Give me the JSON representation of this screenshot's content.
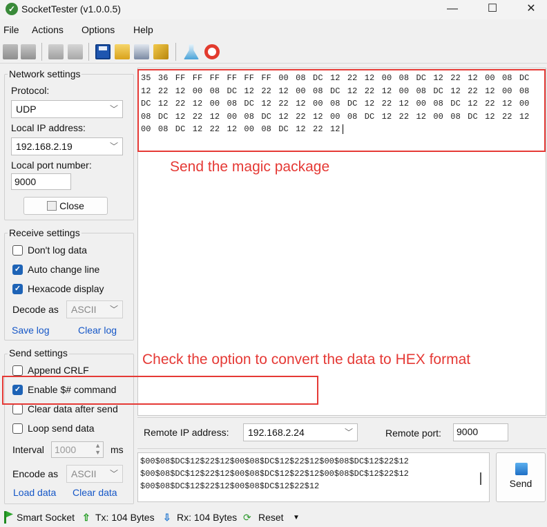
{
  "window": {
    "title": "SocketTester (v1.0.0.5)",
    "minimize": "—",
    "maximize": "☐",
    "close": "✕"
  },
  "menu": [
    {
      "label": "File"
    },
    {
      "label": "Actions"
    },
    {
      "label": "Options"
    },
    {
      "label": "Help"
    }
  ],
  "toolbar_icons": [
    "connect-icon",
    "disconnect-icon",
    "send-file-icon",
    "stop-icon",
    "save-icon",
    "open-folder-icon",
    "print-icon",
    "clear-broom-icon",
    "test-flask-icon",
    "help-lifebuoy-icon"
  ],
  "network": {
    "title": "Network settings",
    "protocol_label": "Protocol:",
    "protocol_value": "UDP",
    "local_ip_label": "Local IP address:",
    "local_ip_value": "192.168.2.19",
    "local_port_label": "Local port number:",
    "local_port_value": "9000",
    "close_label": "Close"
  },
  "receive": {
    "title": "Receive settings",
    "dont_log": {
      "label": "Don't log data",
      "checked": false
    },
    "auto_change_line": {
      "label": "Auto change line",
      "checked": true
    },
    "hexcode_display": {
      "label": "Hexacode display",
      "checked": true
    },
    "decode_label": "Decode as",
    "decode_value": "ASCII",
    "save_log": "Save log",
    "clear_log": "Clear log"
  },
  "send_settings": {
    "title": "Send settings",
    "append_crlf": {
      "label": "Append CRLF",
      "checked": false
    },
    "enable_cmd": {
      "label": "Enable $# command",
      "checked": true
    },
    "clear_after_send": {
      "label": "Clear data after send",
      "checked": false
    },
    "loop_send": {
      "label": "Loop send data",
      "checked": false
    },
    "interval_label": "Interval",
    "interval_value": "1000",
    "interval_unit": "ms",
    "encode_label": "Encode as",
    "encode_value": "ASCII",
    "load_data": "Load data",
    "clear_data": "Clear data"
  },
  "receive_log": {
    "lines": [
      "35 36 FF FF FF FF FF FF 00 08 DC 12 22 12 00 08 DC 12 22 12 00 08 DC",
      "12 22 12 00 08 DC 12 22 12 00 08 DC 12 22 12 00 08 DC 12 22 12 00 08",
      "DC 12 22 12 00 08 DC 12 22 12 00 08 DC 12 22 12 00 08 DC 12 22 12 00",
      "08 DC 12 22 12 00 08 DC 12 22 12 00 08 DC 12 22 12 00 08 DC 12 22 12",
      "00 08 DC 12 22 12 00 08 DC 12 22 12"
    ]
  },
  "annotations": {
    "magic": "Send the magic package",
    "hex": "Check the option to convert the data to HEX format"
  },
  "remote": {
    "ip_label": "Remote IP address:",
    "ip_value": "192.168.2.24",
    "port_label": "Remote port:",
    "port_value": "9000"
  },
  "send_box": {
    "lines": [
      "$00$08$DC$12$22$12$00$08$DC$12$22$12$00$08$DC$12$22$12",
      "$00$08$DC$12$22$12$00$08$DC$12$22$12$00$08$DC$12$22$12",
      "$00$08$DC$12$22$12$00$08$DC$12$22$12"
    ],
    "send_label": "Send"
  },
  "status": {
    "smart_socket": "Smart Socket",
    "tx": "Tx: 104 Bytes",
    "rx": "Rx: 104 Bytes",
    "reset": "Reset"
  },
  "colors": {
    "annotation": "#e53935",
    "link": "#1456c7",
    "checkbox": "#1e63b6"
  }
}
